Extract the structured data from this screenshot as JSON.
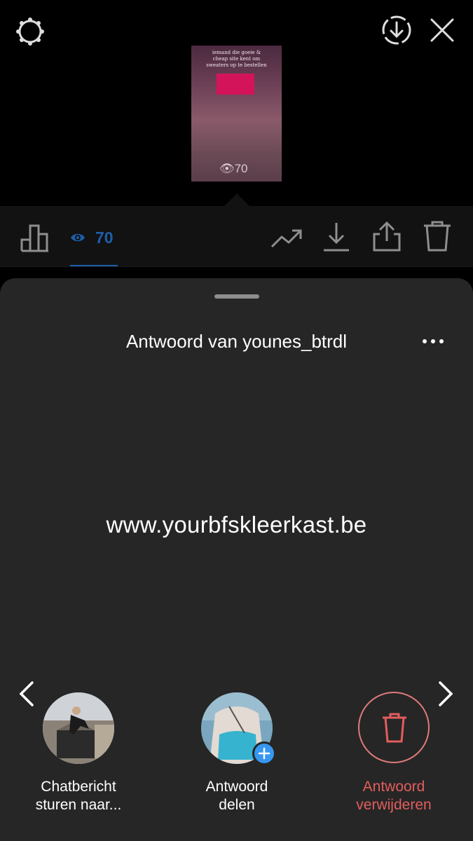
{
  "story_preview": {
    "caption_lines": [
      "iemand die goeie &",
      "cheap site kent om",
      "sweaters op te bestellen"
    ],
    "views": "70"
  },
  "stats_bar": {
    "viewers_count": "70"
  },
  "sheet": {
    "title": "Antwoord van younes_btrdl",
    "answer": "www.yourbfskleerkast.be"
  },
  "actions": [
    {
      "line1": "Chatbericht",
      "line2": "sturen naar..."
    },
    {
      "line1": "Antwoord",
      "line2": "delen"
    },
    {
      "line1": "Antwoord",
      "line2": "verwijderen"
    }
  ],
  "colors": {
    "accent_blue": "#1c5ea8",
    "badge_blue": "#3797f0",
    "danger_red": "#e35d5d",
    "sheet_bg": "#262626"
  },
  "icons": [
    "gear-icon",
    "download-circle-icon",
    "close-icon",
    "bar-chart-icon",
    "eye-icon",
    "trend-icon",
    "download-icon",
    "share-icon",
    "trash-icon",
    "more-icon",
    "chevron-left-icon",
    "chevron-right-icon",
    "plus-icon"
  ]
}
